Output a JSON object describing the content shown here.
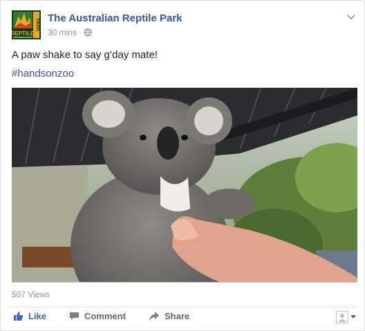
{
  "post": {
    "page_name": "The Australian Reptile Park",
    "time": "30 mins",
    "separator": "·",
    "text": "A paw shake to say g’day mate!",
    "hashtag": "#handsonzoo",
    "views": "507 Views",
    "logo_text": "REPTILE",
    "logo_side_text": "PARK",
    "privacy_icon": "globe-icon",
    "menu_icon": "chevron-down-icon"
  },
  "actions": {
    "like": "Like",
    "comment": "Comment",
    "share": "Share"
  },
  "colors": {
    "link": "#365899",
    "like_blue": "#4267b2",
    "meta_gray": "#90949c",
    "action_gray": "#616770",
    "text": "#1d2129"
  }
}
